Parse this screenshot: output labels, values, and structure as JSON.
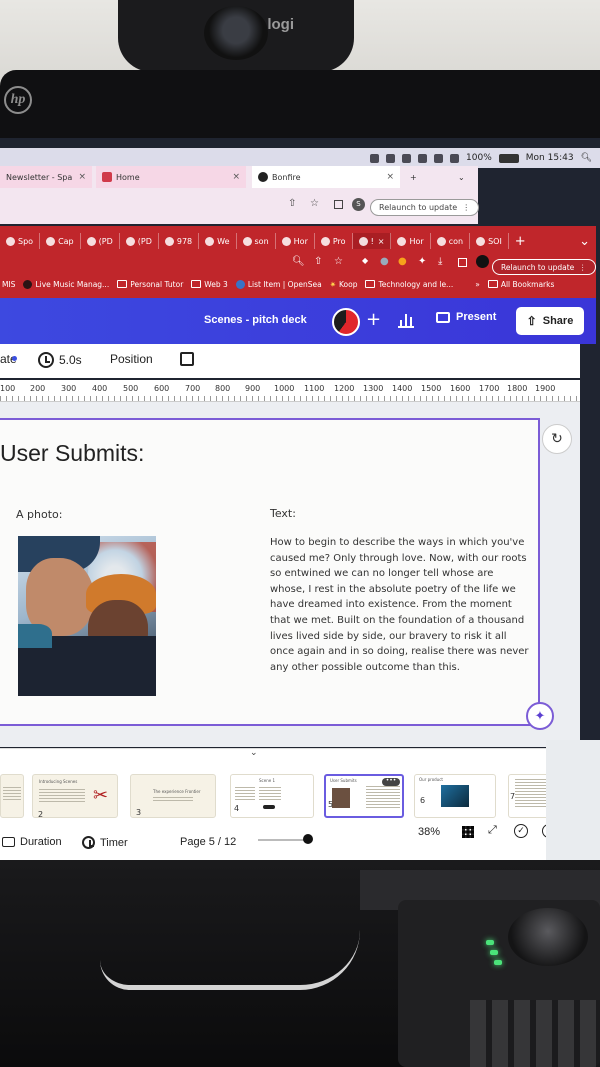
{
  "webcam_brand": "logi",
  "monitor_brand": "hp",
  "menubar": {
    "battery": "100%",
    "datetime": "Mon 15:43"
  },
  "back_window": {
    "tabs": [
      {
        "label": "Newsletter - Spa"
      },
      {
        "label": "Home"
      },
      {
        "label": "Bonfire"
      }
    ],
    "relaunch": "Relaunch to update",
    "profile_initial": "S"
  },
  "front_window": {
    "tabs": [
      "Spo",
      "Cap",
      "(PD",
      "(PD",
      "978",
      "We",
      "son",
      "Hor",
      "Pro",
      "!",
      "Hor",
      "con",
      "SOI"
    ],
    "relaunch": "Relaunch to update",
    "bookmarks": [
      "MIS",
      "Live Music Manag...",
      "Personal Tutor",
      "Web 3",
      "List Item | OpenSea",
      "Koop",
      "Technology and le...",
      "All Bookmarks"
    ]
  },
  "canva": {
    "doc_title": "Scenes - pitch deck",
    "present": "Present",
    "share": "Share",
    "toolbar": {
      "animate": "ate",
      "duration": "5.0s",
      "position": "Position"
    },
    "ruler": [
      "100",
      "200",
      "300",
      "400",
      "500",
      "600",
      "700",
      "800",
      "900",
      "1000",
      "1100",
      "1200",
      "1300",
      "1400",
      "1500",
      "1600",
      "1700",
      "1800",
      "1900"
    ],
    "slide": {
      "title": "User Submits:",
      "photo_label": "A photo:",
      "text_label": "Text:",
      "body": "How to begin to describe the ways in which you've caused me? Only through love. Now, with our roots so entwined we can no longer tell whose are whose, I rest in the absolute poetry of the life we have dreamed into existence. From the moment that we met. Built on the foundation of a thousand lives lived side by side, our bravery to risk it all once again and in so doing, realise there was never any other possible outcome than this."
    },
    "thumbnails": [
      {
        "num": "2",
        "title": "Introducing Scenes"
      },
      {
        "num": "3",
        "title": "The experience Frontier"
      },
      {
        "num": "4",
        "title": "Scene 1"
      },
      {
        "num": "5",
        "title": "User Submits"
      },
      {
        "num": "6",
        "title": "Our product"
      },
      {
        "num": "7",
        "title": ""
      }
    ],
    "bottom": {
      "duration": "Duration",
      "timer": "Timer",
      "page": "Page 5 / 12",
      "zoom": "38%",
      "help": "?"
    }
  },
  "colors": {
    "canva_blue": "#3d49e0",
    "chrome_red": "#c0262b",
    "selection_purple": "#7b5cd6"
  }
}
